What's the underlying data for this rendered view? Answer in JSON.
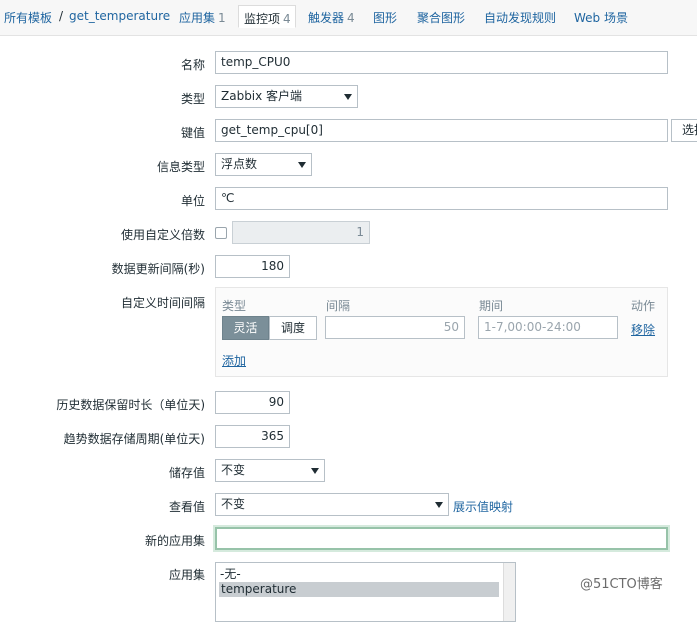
{
  "nav": {
    "all_templates": "所有模板",
    "separator": "/",
    "template_name": "get_temperature",
    "applications": {
      "label": "应用集",
      "count": "1"
    },
    "items": {
      "label": "监控项",
      "count": "4"
    },
    "triggers": {
      "label": "触发器",
      "count": "4"
    },
    "graphs": "图形",
    "screens": "聚合图形",
    "discovery": "自动发现规则",
    "web": "Web 场景"
  },
  "form": {
    "name": {
      "label": "名称",
      "value": "temp_CPU0"
    },
    "type": {
      "label": "类型",
      "value": "Zabbix 客户端"
    },
    "key": {
      "label": "键值",
      "value": "get_temp_cpu[0]",
      "button": "选择"
    },
    "value_type": {
      "label": "信息类型",
      "value": "浮点数"
    },
    "units": {
      "label": "单位",
      "value": "℃"
    },
    "multiplier": {
      "label": "使用自定义倍数",
      "value": "1"
    },
    "delay": {
      "label": "数据更新间隔(秒)",
      "value": "180"
    },
    "custom_intervals": {
      "label": "自定义时间间隔",
      "col_type": "类型",
      "col_interval": "间隔",
      "col_period": "期间",
      "col_action": "动作",
      "flexible": "灵活",
      "scheduling": "调度",
      "interval_placeholder": "50",
      "period_placeholder": "1-7,00:00-24:00",
      "remove": "移除",
      "add": "添加"
    },
    "history": {
      "label": "历史数据保留时长（单位天)",
      "value": "90"
    },
    "trends": {
      "label": "趋势数据存储周期(单位天)",
      "value": "365"
    },
    "store_value": {
      "label": "储存值",
      "value": "不变"
    },
    "show_value": {
      "label": "查看值",
      "value": "不变",
      "link": "展示值映射"
    },
    "new_application": {
      "label": "新的应用集",
      "value": ""
    },
    "applications": {
      "label": "应用集",
      "options": [
        "-无-",
        "temperature"
      ]
    }
  },
  "watermark": "@51CTO博客"
}
